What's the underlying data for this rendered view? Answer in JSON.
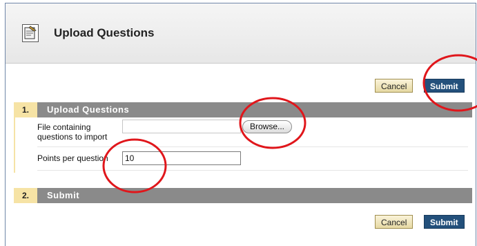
{
  "page": {
    "title": "Upload Questions"
  },
  "icons": {
    "header": "upload-document-icon"
  },
  "buttons": {
    "cancel_label": "Cancel",
    "submit_label": "Submit",
    "browse_label": "Browse..."
  },
  "steps": [
    {
      "number": "1.",
      "title": "Upload Questions"
    },
    {
      "number": "2.",
      "title": "Submit"
    }
  ],
  "fields": {
    "file_label_line1": "File containing",
    "file_label_line2": "questions to import",
    "points_label": "Points per question",
    "points_value": "10"
  },
  "colors": {
    "submit_bg": "#23507b",
    "cancel_bg": "#e6d9a3",
    "step_bar": "#8a8a8a",
    "step_num_bg": "#f6e3a5",
    "highlight_circle": "#e0161b"
  }
}
